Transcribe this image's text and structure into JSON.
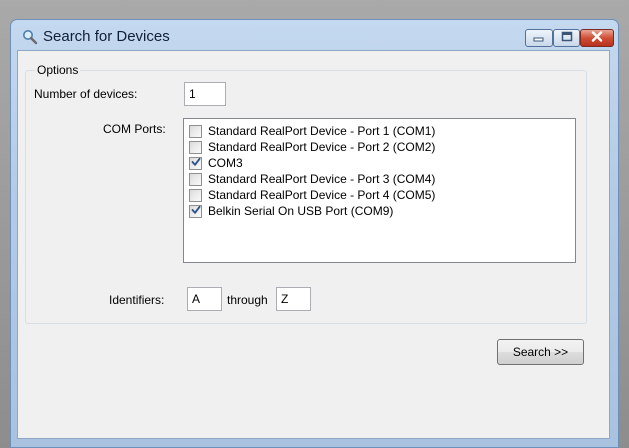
{
  "window": {
    "title": "Search for Devices",
    "icon": "search-icon",
    "controls": [
      "minimize-icon",
      "maximize-icon",
      "close-icon"
    ]
  },
  "options": {
    "group_label": "Options",
    "num_devices_label": "Number of devices:",
    "num_devices_value": "1",
    "com_ports_label": "COM Ports:",
    "com_ports": [
      {
        "label": "Standard RealPort Device - Port 1 (COM1)",
        "checked": false
      },
      {
        "label": "Standard RealPort Device - Port 2 (COM2)",
        "checked": false
      },
      {
        "label": "COM3",
        "checked": true
      },
      {
        "label": "Standard RealPort Device - Port 3 (COM4)",
        "checked": false
      },
      {
        "label": "Standard RealPort Device - Port 4 (COM5)",
        "checked": false
      },
      {
        "label": "Belkin Serial On USB Port (COM9)",
        "checked": true
      }
    ],
    "identifiers_label": "Identifiers:",
    "identifier_from": "A",
    "through_label": "through",
    "identifier_to": "Z"
  },
  "actions": {
    "search_label": "Search >>"
  },
  "colors": {
    "title_bar": "#b3cbe6",
    "close_button": "#cf4e35",
    "client_bg": "#f0f0f0"
  }
}
